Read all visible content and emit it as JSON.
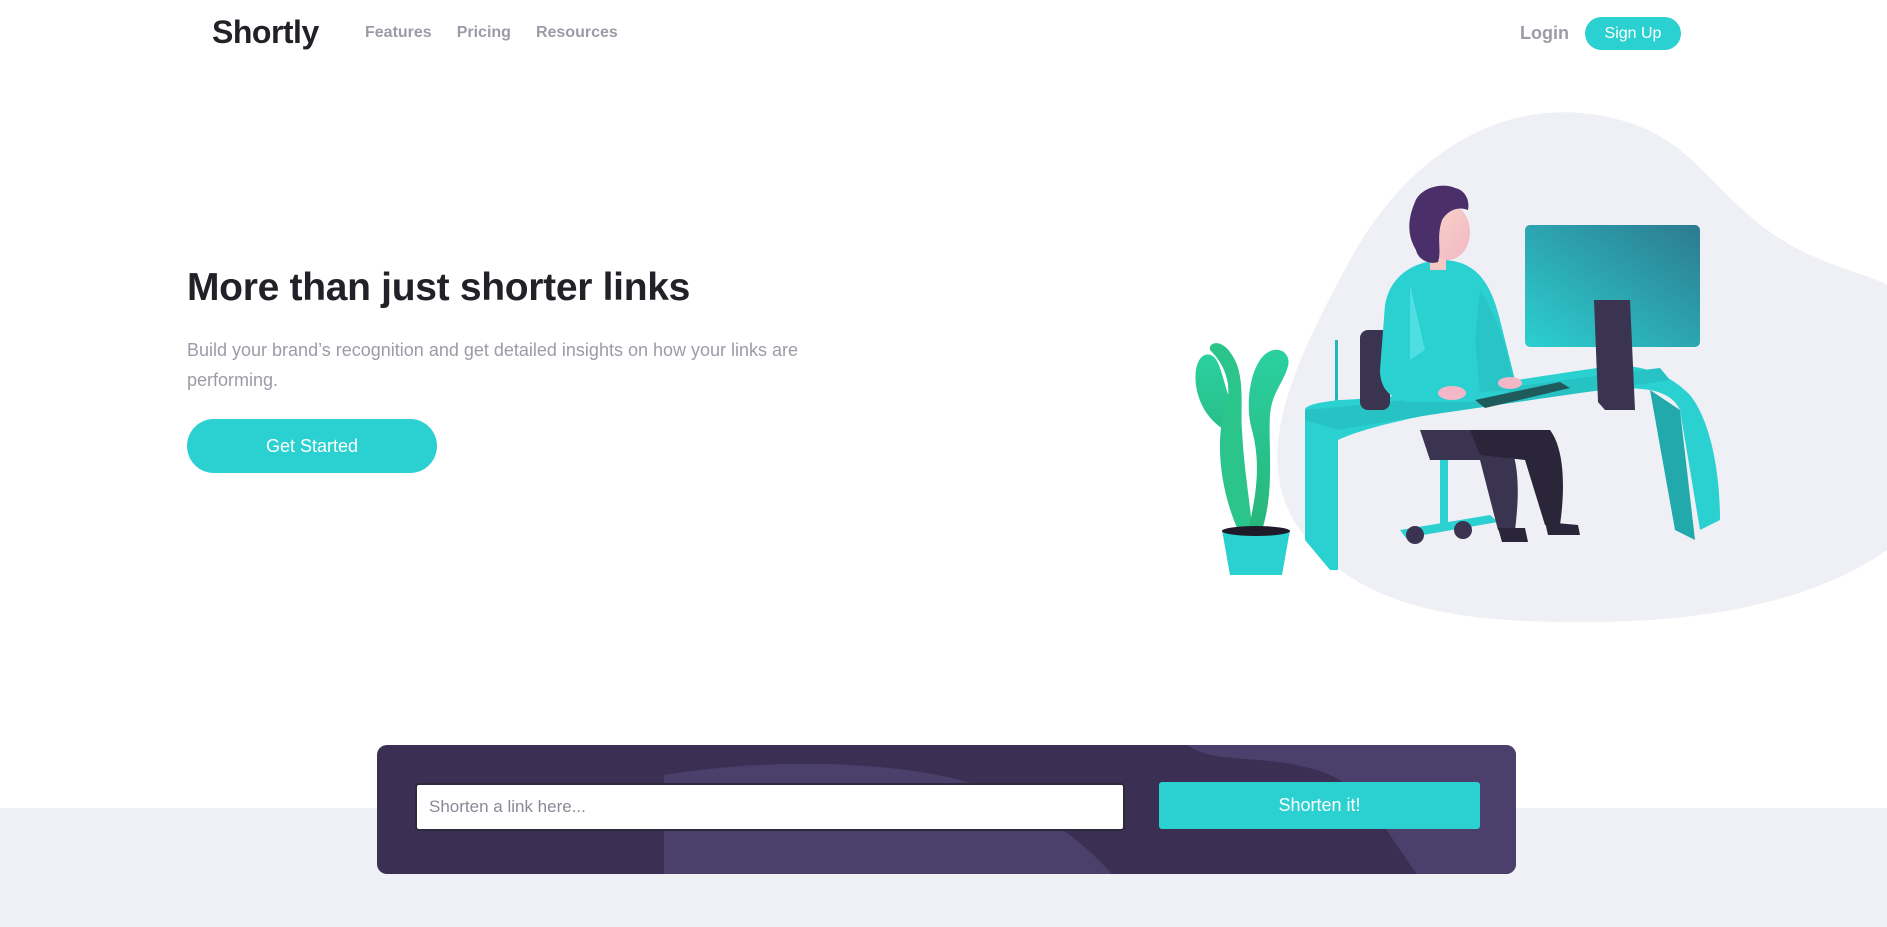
{
  "header": {
    "logo": "Shortly",
    "nav": [
      "Features",
      "Pricing",
      "Resources"
    ],
    "login": "Login",
    "signup": "Sign Up"
  },
  "hero": {
    "title": "More than just shorter links",
    "description": "Build your brand’s recognition and get detailed insights on how your links are performing.",
    "cta": "Get Started",
    "illustration_icon": "person-working-at-desk-illustration"
  },
  "shorten": {
    "placeholder": "Shorten a link here...",
    "value": "",
    "button": "Shorten it!"
  },
  "colors": {
    "primary_cyan": "#2bd0d0",
    "dark_violet": "#3b3054",
    "very_dark_blue": "#232127",
    "gray_text": "#9e9aa7",
    "light_gray_bg": "#eff1f7"
  }
}
